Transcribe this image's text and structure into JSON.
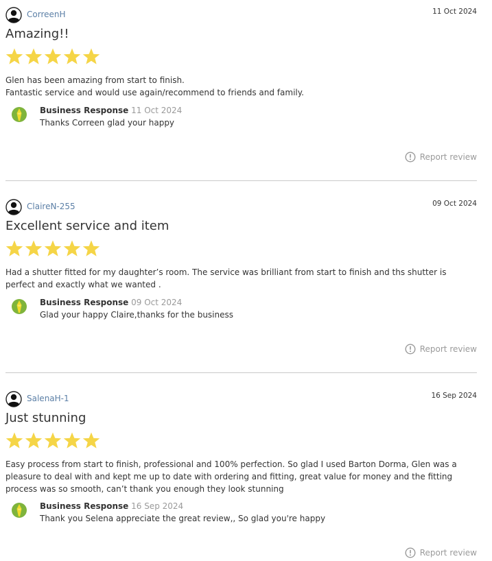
{
  "reviews": [
    {
      "author": "CorreenH",
      "date": "11 Oct 2024",
      "title": "Amazing!!",
      "rating": 5,
      "body_lines": [
        "Glen has been amazing from start to finish.",
        "Fantastic service and would use again/recommend to friends and family."
      ],
      "response": {
        "label": "Business Response",
        "date": "11 Oct 2024",
        "text": "Thanks Correen glad your happy"
      },
      "report_label": "Report review"
    },
    {
      "author": "ClaireN-255",
      "date": "09 Oct 2024",
      "title": "Excellent service and item",
      "rating": 5,
      "body_lines": [
        "Had a shutter fitted for my daughter’s room. The service was brilliant from start to finish and ths shutter is",
        "perfect and exactly what we wanted ."
      ],
      "response": {
        "label": "Business Response",
        "date": "09 Oct 2024",
        "text": "Glad your happy Claire,thanks for the business"
      },
      "report_label": "Report review"
    },
    {
      "author": "SalenaH-1",
      "date": "16 Sep 2024",
      "title": "Just stunning",
      "rating": 5,
      "body_lines": [
        "Easy process from start to finish, professional and 100% perfection. So glad I used Barton Dorma, Glen was a",
        "pleasure to deal with and kept me up to date with ordering and fitting, great value for money and the fitting",
        "process was so smooth, can’t thank you enough they look stunning"
      ],
      "response": {
        "label": "Business Response",
        "date": "16 Sep 2024",
        "text": "Thank you Selena appreciate the great review,, So glad you're happy"
      },
      "report_label": "Report review"
    }
  ],
  "colors": {
    "star": "#f5d547",
    "author_link": "#5b7fa6",
    "muted": "#9a9a9a",
    "divider": "#c9c9c9",
    "badge_green": "#7fb43c",
    "badge_yellow": "#f2dc2a"
  },
  "icons": {
    "avatar": "user-avatar-icon",
    "response": "business-badge-icon",
    "report": "exclamation-circle-icon",
    "star": "star-icon"
  }
}
